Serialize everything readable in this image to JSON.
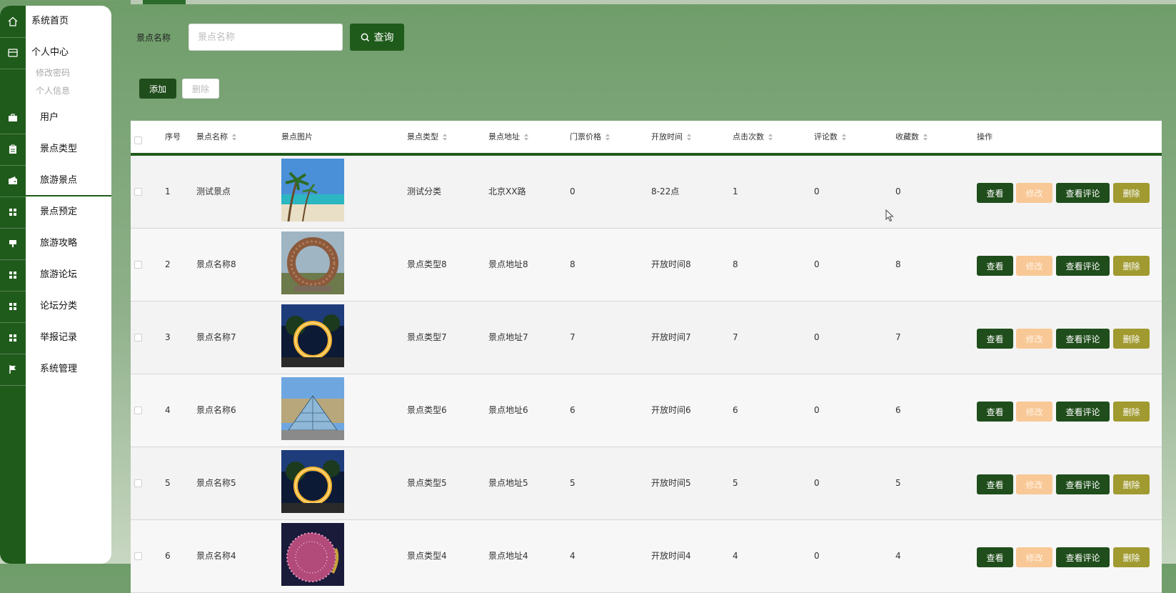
{
  "sidebar": {
    "home": "系统首页",
    "personal": "个人中心",
    "change_password": "修改密码",
    "personal_info": "个人信息",
    "items": [
      {
        "label": "用户",
        "icon": "briefcase-icon"
      },
      {
        "label": "景点类型",
        "icon": "clipboard-icon"
      },
      {
        "label": "旅游景点",
        "icon": "wallet-icon"
      },
      {
        "label": "景点预定",
        "icon": "grid-icon"
      },
      {
        "label": "旅游攻略",
        "icon": "stamp-icon"
      },
      {
        "label": "旅游论坛",
        "icon": "grid-icon"
      },
      {
        "label": "论坛分类",
        "icon": "grid-icon"
      },
      {
        "label": "举报记录",
        "icon": "grid-icon"
      },
      {
        "label": "系统管理",
        "icon": "flag-icon"
      }
    ]
  },
  "search": {
    "label": "景点名称",
    "placeholder": "景点名称",
    "value": "",
    "button": "查询"
  },
  "toolbar": {
    "add": "添加",
    "delete": "删除"
  },
  "table": {
    "headers": {
      "index": "序号",
      "name": "景点名称",
      "image": "景点图片",
      "type": "景点类型",
      "address": "景点地址",
      "price": "门票价格",
      "open_time": "开放时间",
      "clicks": "点击次数",
      "comments": "评论数",
      "favorites": "收藏数",
      "actions": "操作"
    },
    "actions": {
      "view": "查看",
      "edit": "修改",
      "view_comments": "查看评论",
      "delete": "删除"
    },
    "rows": [
      {
        "index": "1",
        "name": "测试景点",
        "image": "beach-palm",
        "type": "测试分类",
        "address": "北京XX路",
        "price": "0",
        "open_time": "8-22点",
        "clicks": "1",
        "comments": "0",
        "favorites": "0"
      },
      {
        "index": "2",
        "name": "景点名称8",
        "image": "nest-ring",
        "type": "景点类型8",
        "address": "景点地址8",
        "price": "8",
        "open_time": "开放时间8",
        "clicks": "8",
        "comments": "0",
        "favorites": "8"
      },
      {
        "index": "3",
        "name": "景点名称7",
        "image": "light-ring-night",
        "type": "景点类型7",
        "address": "景点地址7",
        "price": "7",
        "open_time": "开放时间7",
        "clicks": "7",
        "comments": "0",
        "favorites": "7"
      },
      {
        "index": "4",
        "name": "景点名称6",
        "image": "glass-pyramid",
        "type": "景点类型6",
        "address": "景点地址6",
        "price": "6",
        "open_time": "开放时间6",
        "clicks": "6",
        "comments": "0",
        "favorites": "6"
      },
      {
        "index": "5",
        "name": "景点名称5",
        "image": "light-ring-night",
        "type": "景点类型5",
        "address": "景点地址5",
        "price": "5",
        "open_time": "开放时间5",
        "clicks": "5",
        "comments": "0",
        "favorites": "5"
      },
      {
        "index": "6",
        "name": "景点名称4",
        "image": "lantern-sculpture",
        "type": "景点类型4",
        "address": "景点地址4",
        "price": "4",
        "open_time": "开放时间4",
        "clicks": "4",
        "comments": "0",
        "favorites": "4"
      }
    ]
  },
  "colors": {
    "primary": "#1f5b1b",
    "edit": "#f8c896",
    "delete": "#a09a31"
  }
}
